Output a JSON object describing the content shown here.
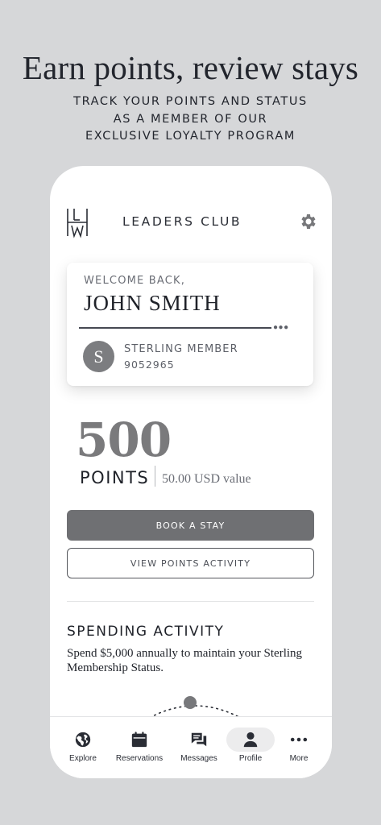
{
  "promo": {
    "headline": "Earn points, review stays",
    "subline": [
      "TRACK YOUR POINTS AND STATUS",
      "AS A MEMBER OF OUR",
      "EXCLUSIVE LOYALTY PROGRAM"
    ]
  },
  "header": {
    "logo_icon": "lhw-monogram-icon",
    "brand": "LEADERS CLUB",
    "settings_icon": "gear-icon"
  },
  "member_card": {
    "welcome": "WELCOME BACK,",
    "name": "JOHN SMITH",
    "tier": "STERLING MEMBER",
    "member_number": "9052965",
    "badge_letter": "S",
    "badge_color": "#7c7d80"
  },
  "points": {
    "value": "500",
    "label": "POINTS",
    "usd_value": "50.00 USD value"
  },
  "actions": {
    "book": "BOOK A STAY",
    "activity": "VIEW POINTS ACTIVITY"
  },
  "spending": {
    "title": "SPENDING ACTIVITY",
    "description": "Spend $5,000 annually to maintain your Sterling Membership Status."
  },
  "tabs": [
    {
      "label": "Explore",
      "icon": "globe-icon"
    },
    {
      "label": "Reservations",
      "icon": "calendar-icon"
    },
    {
      "label": "Messages",
      "icon": "chat-icon"
    },
    {
      "label": "Profile",
      "icon": "person-icon",
      "active": true
    },
    {
      "label": "More",
      "icon": "more-dots-icon"
    }
  ],
  "colors": {
    "background": "#d6d7d9",
    "primary_button": "#6f7073",
    "points_number": "#7a7a7c",
    "text_dark": "#1f2229"
  }
}
